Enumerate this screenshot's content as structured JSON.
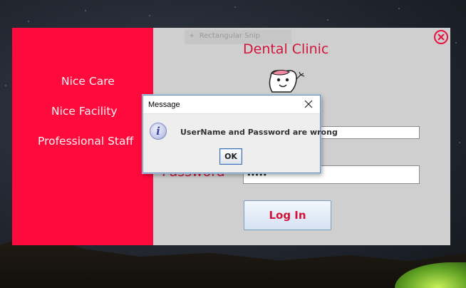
{
  "app": {
    "title": "Dental Clinic",
    "features": [
      "Nice Care",
      "Nice Facility",
      "Professional Staff"
    ],
    "password_label": "Password",
    "password_value": "•••••",
    "login_label": "Log In",
    "close_icon": "close-circle-icon",
    "logo_icon": "tooth-mascot-icon",
    "colors": {
      "accent": "#fe0a3c",
      "title": "#d2143a",
      "panel": "#cfcfcf"
    }
  },
  "snip_overlay": {
    "label": "Rectangular Snip"
  },
  "dialog": {
    "title": "Message",
    "message": "UserName and Password are wrong",
    "ok_label": "OK",
    "icon": "info-icon"
  }
}
